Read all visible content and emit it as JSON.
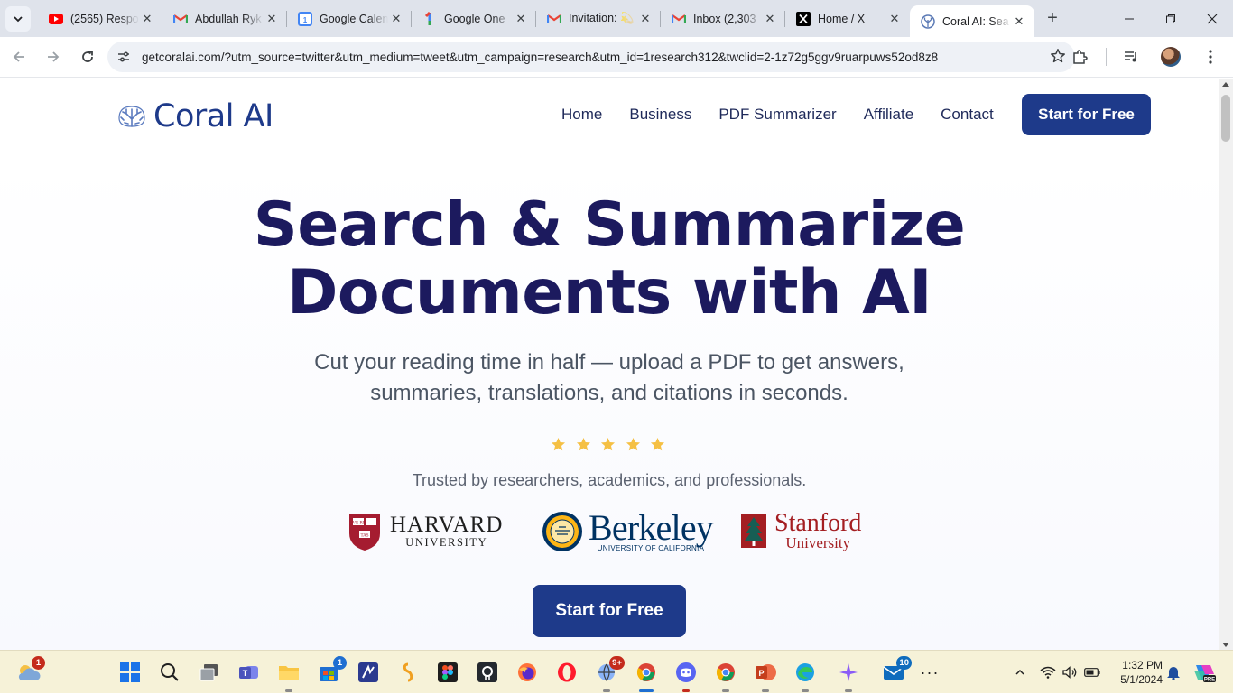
{
  "browser": {
    "tabs": [
      {
        "title": "(2565) Respo",
        "icon": "youtube-icon"
      },
      {
        "title": "Abdullah Ryk",
        "icon": "gmail-icon"
      },
      {
        "title": "Google Calen",
        "icon": "google-calendar-icon"
      },
      {
        "title": "Google One",
        "icon": "google-one-icon"
      },
      {
        "title": "Invitation: 💫",
        "icon": "gmail-icon"
      },
      {
        "title": "Inbox (2,303",
        "icon": "gmail-icon"
      },
      {
        "title": "Home / X",
        "icon": "x-icon"
      },
      {
        "title": "Coral AI: Sea",
        "icon": "coral-icon",
        "active": true
      }
    ],
    "url": "getcoralai.com/?utm_source=twitter&utm_medium=tweet&utm_campaign=research&utm_id=1research312&twclid=2-1z72g5ggv9ruarpuws52od8z8"
  },
  "site": {
    "logo_text": "Coral AI",
    "nav": [
      "Home",
      "Business",
      "PDF Summarizer",
      "Affiliate",
      "Contact"
    ],
    "header_cta": "Start for Free",
    "hero_title_line1": "Search & Summarize",
    "hero_title_line2": "Documents with AI",
    "hero_subtitle_line1": "Cut your reading time in half — upload a PDF to get answers,",
    "hero_subtitle_line2": "summaries, translations, and citations in seconds.",
    "rating_stars": 5,
    "trusted_text": "Trusted by researchers, academics, and professionals.",
    "universities": {
      "harvard": {
        "line1": "HARVARD",
        "line2": "UNIVERSITY",
        "crest": "VE RI TAS"
      },
      "berkeley": {
        "line1": "Berkeley",
        "line2": "UNIVERSITY OF CALIFORNIA"
      },
      "stanford": {
        "line1": "Stanford",
        "line2": "University"
      }
    },
    "main_cta": "Start for Free"
  },
  "taskbar": {
    "weather_badge": "1",
    "store_badge": "1",
    "app_badge_9plus": "9+",
    "mail_badge": "10",
    "time": "1:32 PM",
    "date": "5/1/2024"
  },
  "colors": {
    "brand_navy": "#1e3a8a",
    "heading": "#1c1a5e",
    "star_yellow": "#f5c043",
    "taskbar": "#f6f2d8"
  }
}
